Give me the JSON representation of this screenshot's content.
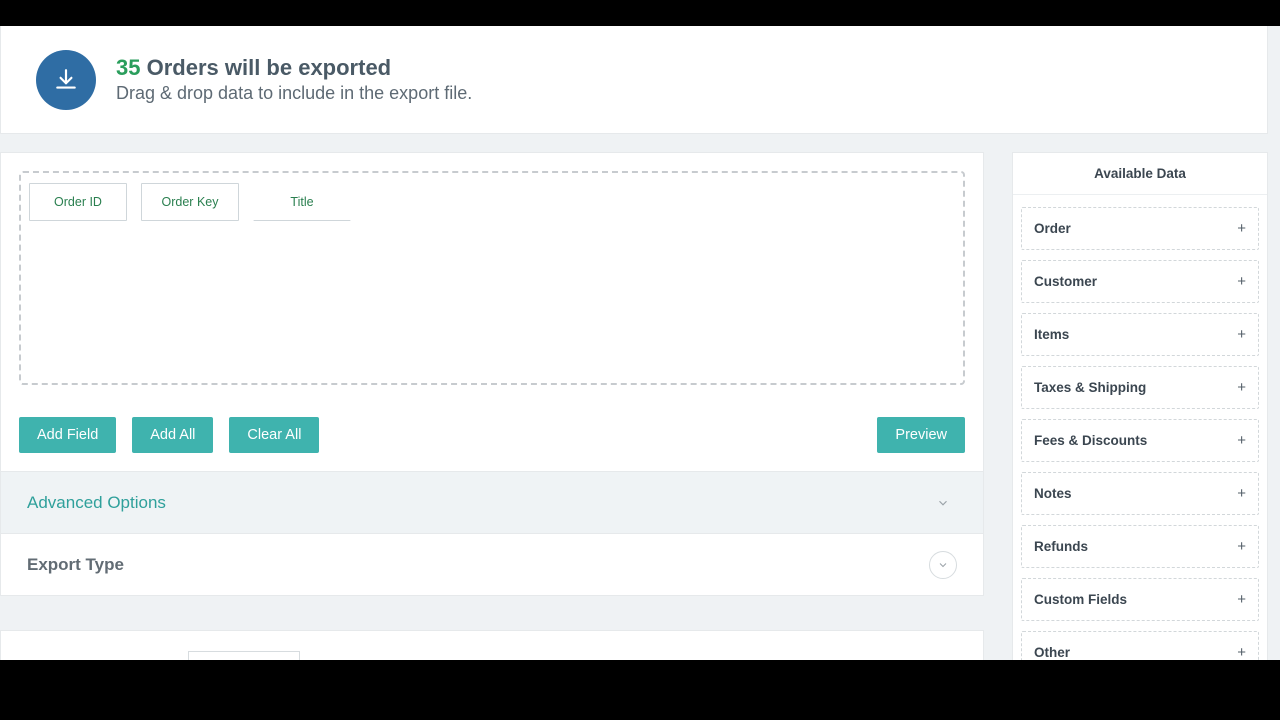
{
  "header": {
    "count": "35",
    "title_suffix": "Orders will be exported",
    "subtitle": "Drag & drop data to include in the export file."
  },
  "chips": [
    "Order ID",
    "Order Key",
    "Title"
  ],
  "buttons": {
    "add_field": "Add Field",
    "add_all": "Add All",
    "clear_all": "Clear All",
    "preview": "Preview"
  },
  "accordions": {
    "advanced": "Advanced Options",
    "export_type": "Export Type"
  },
  "sidebar": {
    "title": "Available Data",
    "categories": [
      "Order",
      "Customer",
      "Items",
      "Taxes & Shipping",
      "Fees & Discounts",
      "Notes",
      "Refunds",
      "Custom Fields",
      "Other"
    ]
  },
  "colors": {
    "accent": "#3fb3ae",
    "header_icon": "#2f6da4",
    "count": "#2a9e5c"
  }
}
